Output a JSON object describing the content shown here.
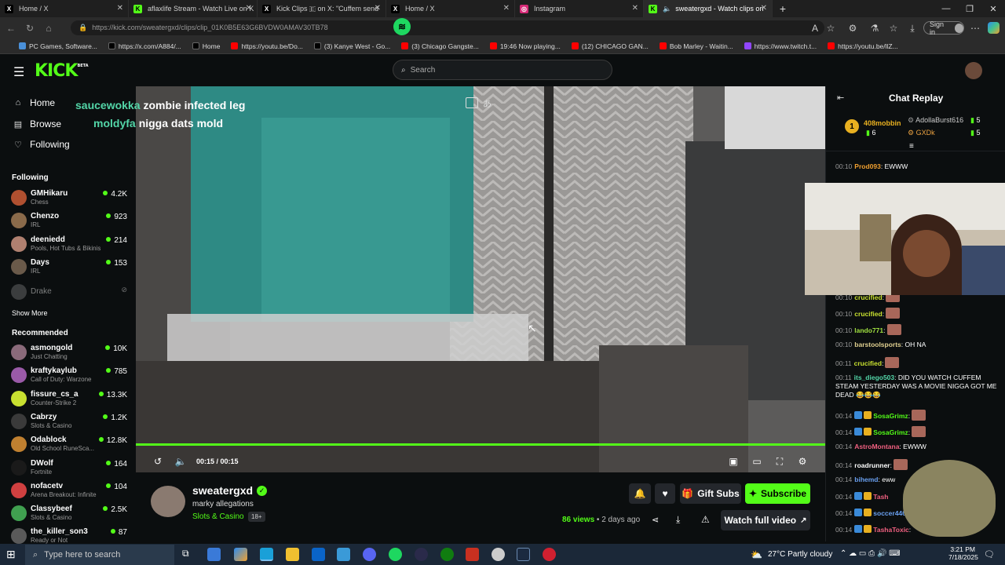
{
  "tabs": [
    {
      "title": "Home / X",
      "fav": "X",
      "color": "#000000"
    },
    {
      "title": "aflaxlife Stream - Watch Live on K",
      "fav": "K",
      "color": "#53fc18"
    },
    {
      "title": "Kick Clips 🇪 on X: \"Cuffem send",
      "fav": "X",
      "color": "#000000"
    },
    {
      "title": "Home / X",
      "fav": "X",
      "color": "#000000"
    },
    {
      "title": "Instagram",
      "fav": "◎",
      "color": "#d62976"
    },
    {
      "title": "sweatergxd - Watch clips on",
      "fav": "K",
      "color": "#53fc18"
    }
  ],
  "browser": {
    "url": "https://kick.com/sweatergxd/clips/clip_01K0B5E63G6BVDW0AMAV30TB78",
    "sign_in": "Sign in"
  },
  "bookmarks": [
    {
      "label": "PC Games, Software...",
      "color": "#4a90d9"
    },
    {
      "label": "https://x.com/A884/...",
      "color": "#000000"
    },
    {
      "label": "Home",
      "color": "#000000"
    },
    {
      "label": "https://youtu.be/Do...",
      "color": "#ff0000"
    },
    {
      "label": "(3) Kanye West - Go...",
      "color": "#000000"
    },
    {
      "label": "(3) Chicago Gangste...",
      "color": "#ff0000"
    },
    {
      "label": "19:46 Now playing...",
      "color": "#ff0000"
    },
    {
      "label": "(12) CHICAGO GAN...",
      "color": "#ff0000"
    },
    {
      "label": "Bob Marley - Waitin...",
      "color": "#ff0000"
    },
    {
      "label": "https://www.twitch.t...",
      "color": "#9146ff"
    },
    {
      "label": "https://youtu.be/llZ...",
      "color": "#ff0000"
    }
  ],
  "header": {
    "logo": "KICK",
    "logo_sup": "BETA",
    "search_placeholder": "Search"
  },
  "nav": {
    "home": "Home",
    "browse": "Browse",
    "following": "Following"
  },
  "sidebar": {
    "following_title": "Following",
    "following": [
      {
        "name": "GMHikaru",
        "category": "Chess",
        "viewers": "4.2K",
        "color": "#b05030"
      },
      {
        "name": "Chenzo",
        "category": "IRL",
        "viewers": "923",
        "color": "#8a6a4a"
      },
      {
        "name": "deeniedd",
        "category": "Pools, Hot Tubs & Bikinis",
        "viewers": "214",
        "color": "#b08070"
      },
      {
        "name": "Days",
        "category": "IRL",
        "viewers": "153",
        "color": "#6a5a4a"
      }
    ],
    "offline": "Drake",
    "show_more": "Show More",
    "recommended_title": "Recommended",
    "recommended": [
      {
        "name": "asmongold",
        "category": "Just Chatting",
        "viewers": "10K",
        "color": "#8a6a7a"
      },
      {
        "name": "kraftykaylub",
        "category": "Call of Duty: Warzone",
        "viewers": "785",
        "color": "#9a5aa8"
      },
      {
        "name": "fissure_cs_a",
        "category": "Counter-Strike 2",
        "viewers": "13.3K",
        "color": "#c8e030"
      },
      {
        "name": "Cabrzy",
        "category": "Slots & Casino",
        "viewers": "1.2K",
        "color": "#3a3a3a"
      },
      {
        "name": "Odablock",
        "category": "Old School RuneSca...",
        "viewers": "12.8K",
        "color": "#c08030"
      },
      {
        "name": "DWolf",
        "category": "Fortnite",
        "viewers": "164",
        "color": "#1a1a1a"
      },
      {
        "name": "nofacetv",
        "category": "Arena Breakout: Infinite",
        "viewers": "104",
        "color": "#d04040"
      },
      {
        "name": "Classybeef",
        "category": "Slots & Casino",
        "viewers": "2.5K",
        "color": "#40a050"
      },
      {
        "name": "the_killer_son3",
        "category": "Ready or Not",
        "viewers": "87",
        "color": "#5a5a5a"
      }
    ]
  },
  "video": {
    "overlay_chat": [
      {
        "user": "saucewokka",
        "msg": "zombie infected leg"
      },
      {
        "user": "moldyfa",
        "msg": "nigga dats mold"
      }
    ],
    "time": "00:15 / 00:15",
    "progress": 1.0
  },
  "clip": {
    "channel": "sweatergxd",
    "title": "marky allegations",
    "category": "Slots & Casino",
    "rating": "18+",
    "views": "86",
    "views_label": "views",
    "age": "2 days ago",
    "gift_subs": "Gift Subs",
    "subscribe": "Subscribe",
    "watch_full": "Watch full video"
  },
  "chat": {
    "title": "Chat Replay",
    "top_gifters": [
      {
        "rank": "1",
        "name": "408mobbin",
        "count": "6"
      },
      {
        "name": "AdollaBurst616",
        "count": "5"
      },
      {
        "name": "GXDk",
        "count": "5"
      }
    ],
    "messages": [
      {
        "t": "00:10",
        "user": "Prod093",
        "color": "#f0a030",
        "msg": ": EWWW"
      },
      {
        "t": "00:10",
        "user": "crucified",
        "color": "#c8e030",
        "msg": ":",
        "emote": true
      },
      {
        "t": "00:10",
        "user": "crucified",
        "color": "#c8e030",
        "msg": ":",
        "emote": true
      },
      {
        "t": "00:10",
        "user": "lando771",
        "color": "#a0e040",
        "msg": ":",
        "emote": true
      },
      {
        "t": "00:10",
        "user": "barstoolsports",
        "color": "#e0d090",
        "msg": ": OH NA"
      },
      {
        "t": "00:11",
        "user": "crucified",
        "color": "#c8e030",
        "msg": ":",
        "emote": true
      },
      {
        "t": "00:11",
        "user": "its_diego503",
        "color": "#53d6a8",
        "msg": ": DID YOU WATCH CUFFEM STEAM YESTERDAY WAS A MOVIE NIGGA GOT ME DEAD 😂😂😂"
      },
      {
        "t": "00:14",
        "user": "SosaGrimz",
        "color": "#53fc18",
        "msg": ":",
        "emote": true
      },
      {
        "t": "00:14",
        "user": "SosaGrimz",
        "color": "#53fc18",
        "msg": ":",
        "emote": true
      },
      {
        "t": "00:14",
        "user": "AstroMontana",
        "color": "#f06080",
        "msg": ": EWWW"
      },
      {
        "t": "00:14",
        "user": "roadrunner",
        "color": "#ffffff",
        "msg": ":",
        "emote": true
      },
      {
        "t": "00:14",
        "user": "bihemd",
        "color": "#6aa0f0",
        "msg": ": eww"
      },
      {
        "t": "00:14",
        "user": "Tash",
        "color": "#f06080",
        "msg": ""
      },
      {
        "t": "00:14",
        "user": "soccer446",
        "color": "#6aa0f0",
        "msg": ": eww"
      },
      {
        "t": "00:14",
        "user": "TashaToxic",
        "color": "#f06080",
        "msg": ":"
      }
    ]
  },
  "taskbar": {
    "search_placeholder": "Type here to search",
    "weather": "27°C  Partly cloudy",
    "time": "3:21 PM",
    "date": "7/18/2025"
  }
}
